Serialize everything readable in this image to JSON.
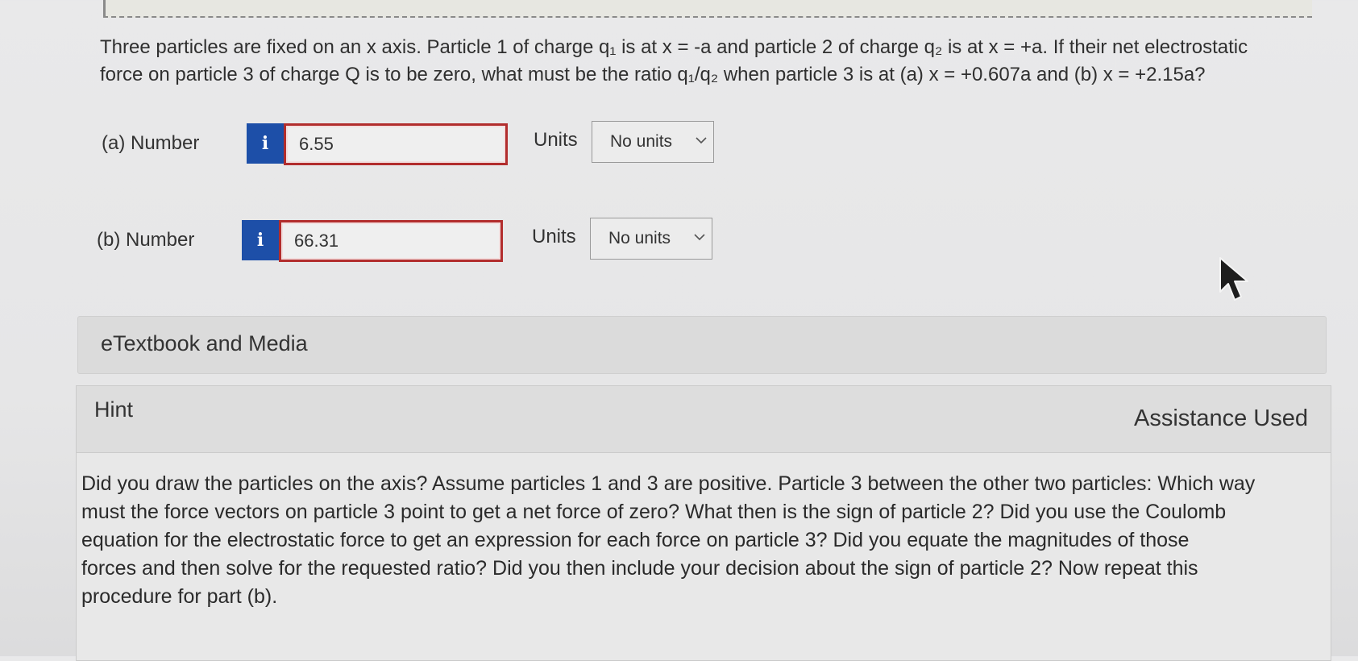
{
  "question": {
    "line1": "Three particles are fixed on an x axis. Particle 1 of charge q₁ is at x = -a and particle 2 of charge q₂ is at x = +a. If their net electrostatic",
    "line2": "force on particle 3 of charge Q is to be zero, what must be the ratio q₁/q₂ when particle 3 is at (a) x = +0.607a and (b) x = +2.15a?"
  },
  "parts": [
    {
      "label": "(a)  Number",
      "info_icon": "i",
      "value": "6.55",
      "units_label": "Units",
      "units_value": "No units"
    },
    {
      "label": "(b)  Number",
      "info_icon": "i",
      "value": "66.31",
      "units_label": "Units",
      "units_value": "No units"
    }
  ],
  "etextbook": {
    "label": "eTextbook and Media"
  },
  "hint": {
    "title": "Hint",
    "assistance": "Assistance Used",
    "lines": [
      "Did you draw the particles on the axis? Assume particles 1 and 3 are positive. Particle 3 between the other two particles: Which way",
      "must the force vectors on particle 3 point to get a net force of zero? What then is the sign of particle 2? Did you use the Coulomb",
      "equation for the electrostatic force to get an expression for each force on particle 3? Did you equate the magnitudes of those",
      "forces and then solve for the requested ratio? Did you then include your decision about the sign of particle 2? Now repeat this",
      "procedure for part (b)."
    ]
  },
  "colors": {
    "info_button": "#1d4fa8",
    "input_border": "#b22d2d"
  },
  "icons": {
    "info": "info-icon",
    "dropdown": "chevron-down-icon",
    "cursor": "mouse-pointer-icon"
  }
}
